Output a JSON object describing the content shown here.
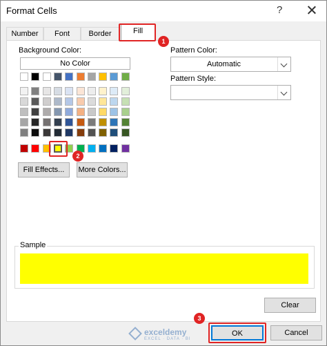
{
  "window": {
    "title": "Format Cells",
    "help_label": "?"
  },
  "tabs": [
    {
      "label": "Number"
    },
    {
      "label": "Font"
    },
    {
      "label": "Border"
    },
    {
      "label": "Fill",
      "active": true
    }
  ],
  "background_color": {
    "label": "Background Color:",
    "no_color_label": "No Color",
    "theme_top_row": [
      "#ffffff",
      "#000000",
      "#ffffff",
      "#44546a",
      "#4472c4",
      "#ed7d31",
      "#a5a5a5",
      "#ffc000",
      "#5b9bd5",
      "#70ad47"
    ],
    "theme_shades": [
      [
        "#f2f2f2",
        "#808080",
        "#e7e6e6",
        "#d6dce4",
        "#dae3f3",
        "#fbe5d6",
        "#ededed",
        "#fff2cc",
        "#ddebf7",
        "#e2efda"
      ],
      [
        "#d9d9d9",
        "#595959",
        "#d0cece",
        "#adb9ca",
        "#b4c7e7",
        "#f8cbad",
        "#dbdbdb",
        "#ffe699",
        "#bdd7ee",
        "#c6e0b4"
      ],
      [
        "#bfbfbf",
        "#404040",
        "#aeabab",
        "#8497b0",
        "#8faadc",
        "#f4b183",
        "#c9c9c9",
        "#ffd966",
        "#9dc3e6",
        "#a9d08e"
      ],
      [
        "#a6a6a6",
        "#262626",
        "#757171",
        "#333f4f",
        "#2f5597",
        "#c55a11",
        "#7b7b7b",
        "#bf8f00",
        "#2e75b6",
        "#548235"
      ],
      [
        "#808080",
        "#0d0d0d",
        "#3a3838",
        "#222b35",
        "#1f3864",
        "#843c0c",
        "#525252",
        "#7f6000",
        "#1f4e79",
        "#375623"
      ]
    ],
    "standard_colors": [
      "#c00000",
      "#ff0000",
      "#ffc000",
      "#ffff00",
      "#92d050",
      "#00b050",
      "#00b0f0",
      "#0070c0",
      "#002060",
      "#7030a0"
    ],
    "selected_standard_index": 3
  },
  "buttons": {
    "fill_effects": "Fill Effects...",
    "more_colors": "More Colors...",
    "clear": "Clear",
    "ok": "OK",
    "cancel": "Cancel"
  },
  "pattern": {
    "color_label": "Pattern Color:",
    "color_value": "Automatic",
    "style_label": "Pattern Style:",
    "style_value": ""
  },
  "sample": {
    "label": "Sample",
    "color": "#ffff00"
  },
  "annotations": [
    "1",
    "2",
    "3"
  ],
  "watermark": {
    "name": "exceldemy",
    "tagline": "EXCEL · DATA · BI"
  }
}
